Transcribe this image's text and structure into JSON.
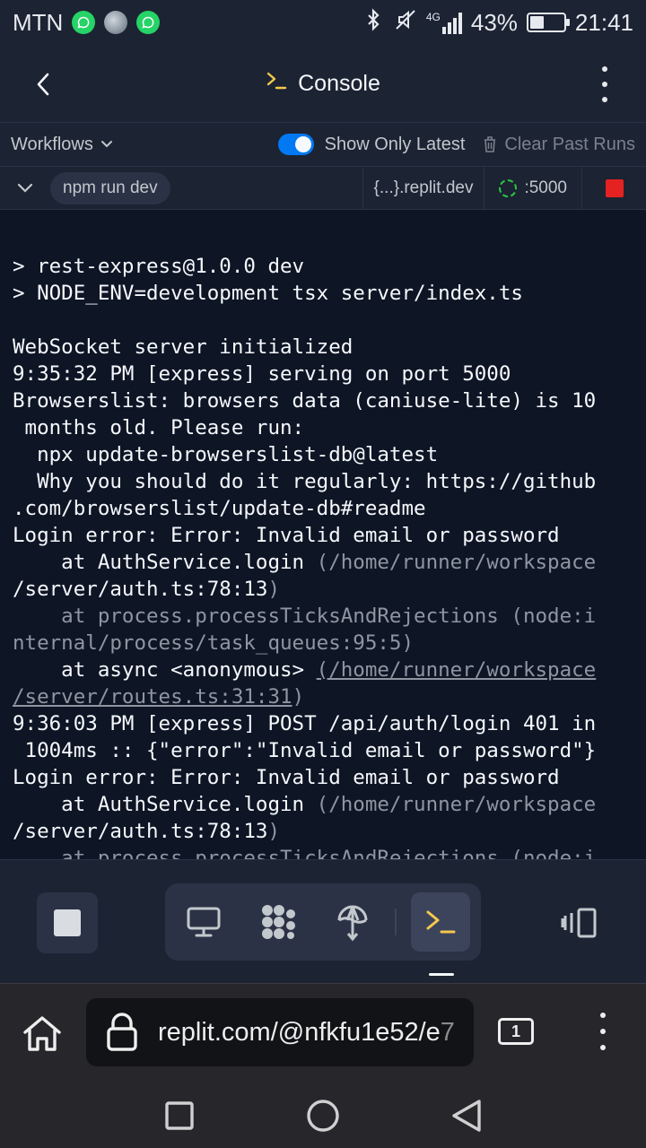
{
  "status_bar": {
    "carrier": "MTN",
    "network": "4G",
    "battery_percent": "43%",
    "battery_level": 0.43,
    "time": "21:41"
  },
  "header": {
    "title": "Console",
    "title_icon": "terminal-prompt-icon"
  },
  "workflows_bar": {
    "workflows_label": "Workflows",
    "show_only_latest_label": "Show Only Latest",
    "show_only_latest_on": true,
    "clear_past_runs_label": "Clear Past Runs"
  },
  "run_row": {
    "command": "npm run dev",
    "url": "{...}.replit.dev",
    "port": ":5000"
  },
  "console": {
    "lines": [
      {
        "text": "> rest-express@1.0.0 dev",
        "style": "normal"
      },
      {
        "text": "> NODE_ENV=development tsx server/index.ts",
        "style": "normal"
      },
      {
        "text": "",
        "style": "normal"
      },
      {
        "text": "WebSocket server initialized",
        "style": "normal"
      },
      {
        "text": "9:35:32 PM [express] serving on port 5000",
        "style": "normal"
      },
      {
        "text": "Browserslist: browsers data (caniuse-lite) is 10",
        "style": "normal"
      },
      {
        "text": " months old. Please run:",
        "style": "normal"
      },
      {
        "text": "  npx update-browserslist-db@latest",
        "style": "normal"
      },
      {
        "text": "  Why you should do it regularly: https://github",
        "style": "normal"
      },
      {
        "text": ".com/browserslist/update-db#readme",
        "style": "normal"
      },
      {
        "text": "Login error: Error: Invalid email or password",
        "style": "normal"
      },
      {
        "parts": [
          {
            "text": "    at AuthService.login ",
            "style": "normal"
          },
          {
            "text": "(/home/runner/workspace",
            "style": "dim"
          }
        ]
      },
      {
        "parts": [
          {
            "text": "/server/auth.ts:78:13",
            "style": "normal"
          },
          {
            "text": ")",
            "style": "dim"
          }
        ]
      },
      {
        "text": "    at process.processTicksAndRejections (node:i",
        "style": "dim"
      },
      {
        "text": "nternal/process/task_queues:95:5)",
        "style": "dim"
      },
      {
        "parts": [
          {
            "text": "    at async <anonymous> ",
            "style": "normal"
          },
          {
            "text": "(/home/runner/workspace",
            "style": "link"
          }
        ]
      },
      {
        "parts": [
          {
            "text": "/server/routes.ts:31:31",
            "style": "link"
          },
          {
            "text": ")",
            "style": "dim"
          }
        ]
      },
      {
        "text": "9:36:03 PM [express] POST /api/auth/login 401 in",
        "style": "normal"
      },
      {
        "text": " 1004ms :: {\"error\":\"Invalid email or password\"}",
        "style": "normal"
      },
      {
        "text": "Login error: Error: Invalid email or password",
        "style": "normal"
      },
      {
        "parts": [
          {
            "text": "    at AuthService.login ",
            "style": "normal"
          },
          {
            "text": "(/home/runner/workspace",
            "style": "dim"
          }
        ]
      },
      {
        "parts": [
          {
            "text": "/server/auth.ts:78:13",
            "style": "normal"
          },
          {
            "text": ")",
            "style": "dim"
          }
        ]
      },
      {
        "text": "    at process.processTicksAndRejections (node:i",
        "style": "dim"
      }
    ]
  },
  "toolbar": {
    "tools": [
      "webview-icon",
      "agent-icon",
      "deployments-icon",
      "console-icon"
    ],
    "active_tool": "console-icon"
  },
  "browser": {
    "url_main": "replit.com/@nfkfu1e52/e",
    "url_fade": "7",
    "tab_count": "1"
  },
  "colors": {
    "accent_blue": "#0079f2",
    "prompt_yellow": "#f5c84c",
    "stop_red": "#e52222",
    "port_green": "#28c840"
  }
}
